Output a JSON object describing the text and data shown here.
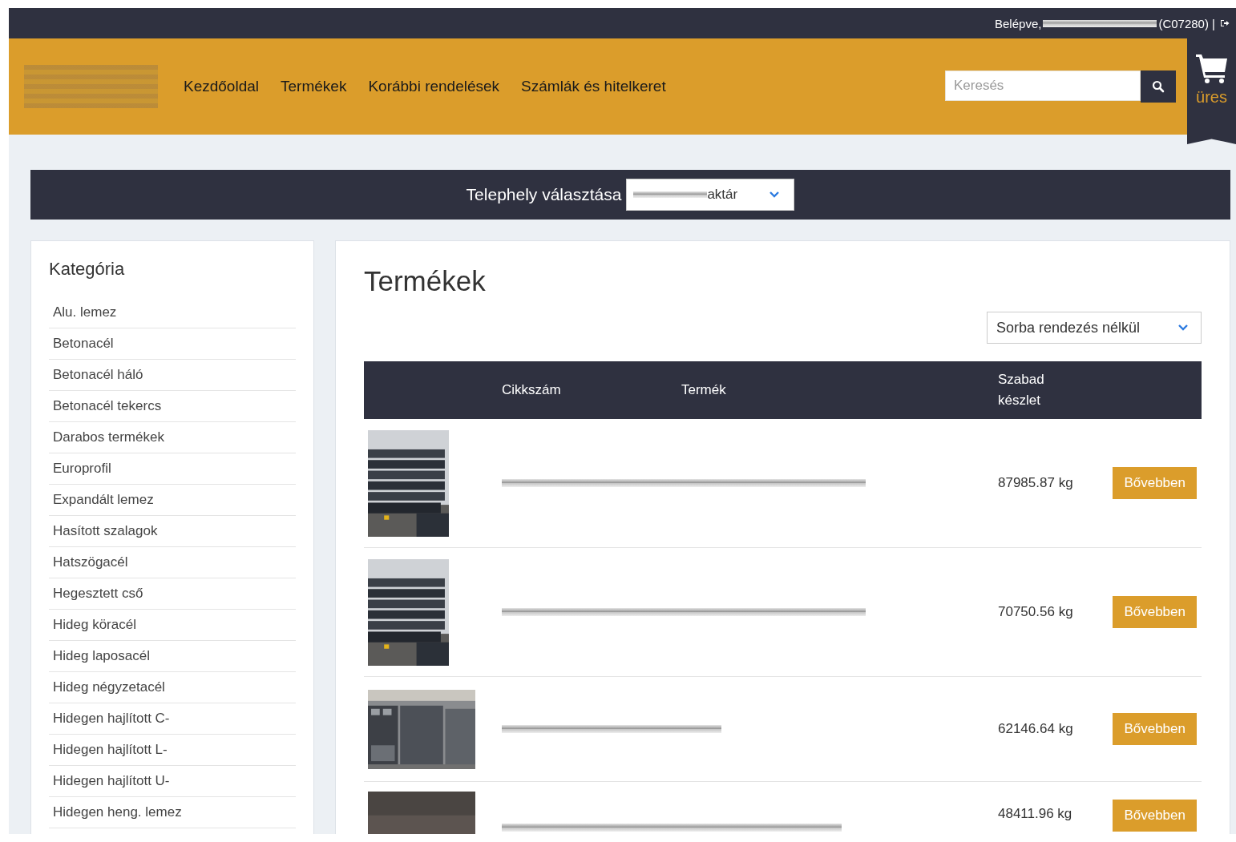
{
  "topbar": {
    "login_label": "Belépve,",
    "customer_code": "(C07280) |"
  },
  "nav": [
    {
      "label": "Kezdőoldal"
    },
    {
      "label": "Termékek"
    },
    {
      "label": "Korábbi rendelések"
    },
    {
      "label": "Számlák és hitelkeret"
    }
  ],
  "search": {
    "placeholder": "Keresés"
  },
  "cart": {
    "label": "üres"
  },
  "location": {
    "label": "Telephely választása",
    "value": "aktár"
  },
  "sidebar": {
    "title": "Kategória",
    "items": [
      {
        "label": "Alu. lemez"
      },
      {
        "label": "Betonacél"
      },
      {
        "label": "Betonacél háló"
      },
      {
        "label": "Betonacél tekercs"
      },
      {
        "label": "Darabos termékek"
      },
      {
        "label": "Europrofil"
      },
      {
        "label": "Expandált lemez"
      },
      {
        "label": "Hasított szalagok"
      },
      {
        "label": "Hatszögacél"
      },
      {
        "label": "Hegesztett cső"
      },
      {
        "label": "Hideg köracél"
      },
      {
        "label": "Hideg laposacél"
      },
      {
        "label": "Hideg négyzetacél"
      },
      {
        "label": "Hidegen hajlított C-"
      },
      {
        "label": "Hidegen hajlított L-"
      },
      {
        "label": "Hidegen hajlított U-"
      },
      {
        "label": "Hidegen heng. lemez"
      }
    ]
  },
  "main": {
    "title": "Termékek",
    "sort": {
      "value": "Sorba rendezés nélkül"
    },
    "table": {
      "columns": [
        "Cikkszám",
        "Termék",
        "Szabad készlet"
      ],
      "rows": [
        {
          "stock": "87985.87 kg",
          "action": "Bővebben"
        },
        {
          "stock": "70750.56 kg",
          "action": "Bővebben"
        },
        {
          "stock": "62146.64 kg",
          "action": "Bővebben"
        },
        {
          "stock": "48411.96 kg",
          "action": "Bővebben"
        }
      ]
    }
  }
}
